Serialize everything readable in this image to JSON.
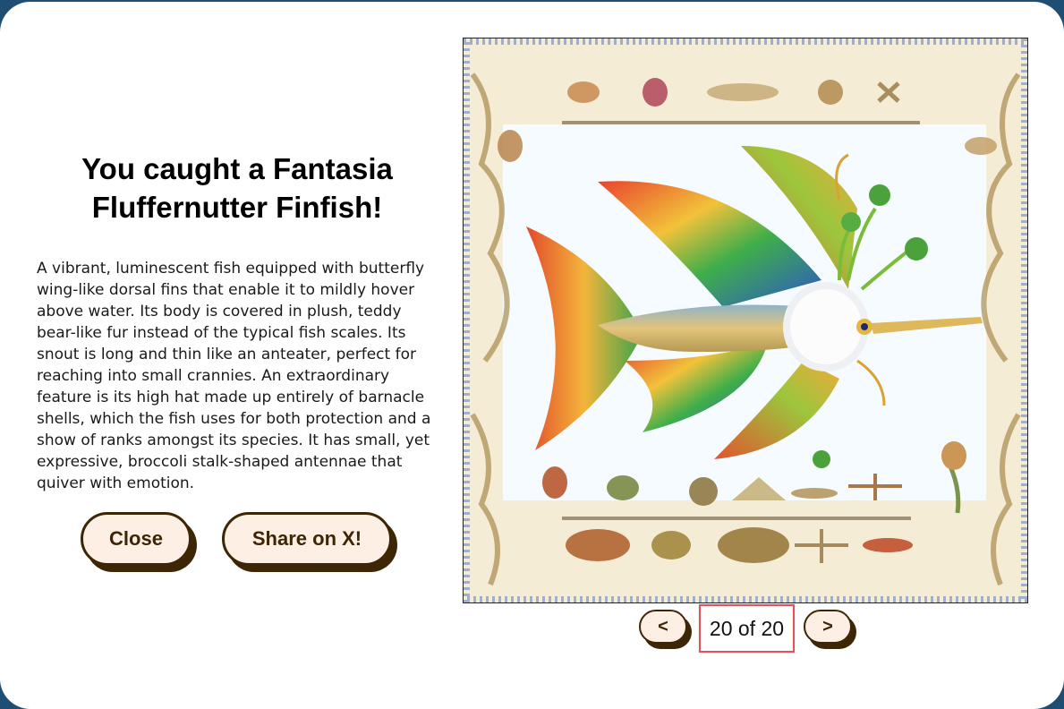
{
  "modal": {
    "title": "You caught a Fantasia Fluffernutter Finfish!",
    "description": "A vibrant, luminescent fish equipped with butterfly wing-like dorsal fins that enable it to mildly hover above water. Its body is covered in plush, teddy bear-like fur instead of the typical fish scales. Its snout is long and thin like an anteater, perfect for reaching into small crannies. An extraordinary feature is its high hat made up entirely of barnacle shells, which the fish uses for both protection and a show of ranks amongst its species. It has small, yet expressive, broccoli stalk-shaped antennae that quiver with emotion.",
    "close_label": "Close",
    "share_label": "Share on X!"
  },
  "pager": {
    "prev_label": "<",
    "next_label": ">",
    "count_text": "20 of 20"
  },
  "colors": {
    "page_background": "#1f4e74",
    "button_fill": "#fdefe4",
    "button_border": "#3d2606",
    "highlight_border": "#e0525c"
  },
  "image": {
    "subject": "fish-illustration"
  }
}
